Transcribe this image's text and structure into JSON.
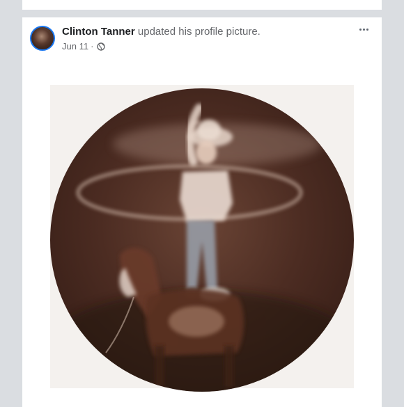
{
  "post": {
    "author": "Clinton Tanner",
    "action": "updated his profile picture.",
    "date": "Jun 11",
    "separator": "·",
    "privacy_icon": "globe-icon",
    "menu_icon": "more-options-icon"
  },
  "colors": {
    "feed_background": "#dadde1",
    "card_background": "#ffffff",
    "avatar_ring": "#1877f2",
    "author_text": "#1c1e21",
    "secondary_text": "#65676b"
  }
}
